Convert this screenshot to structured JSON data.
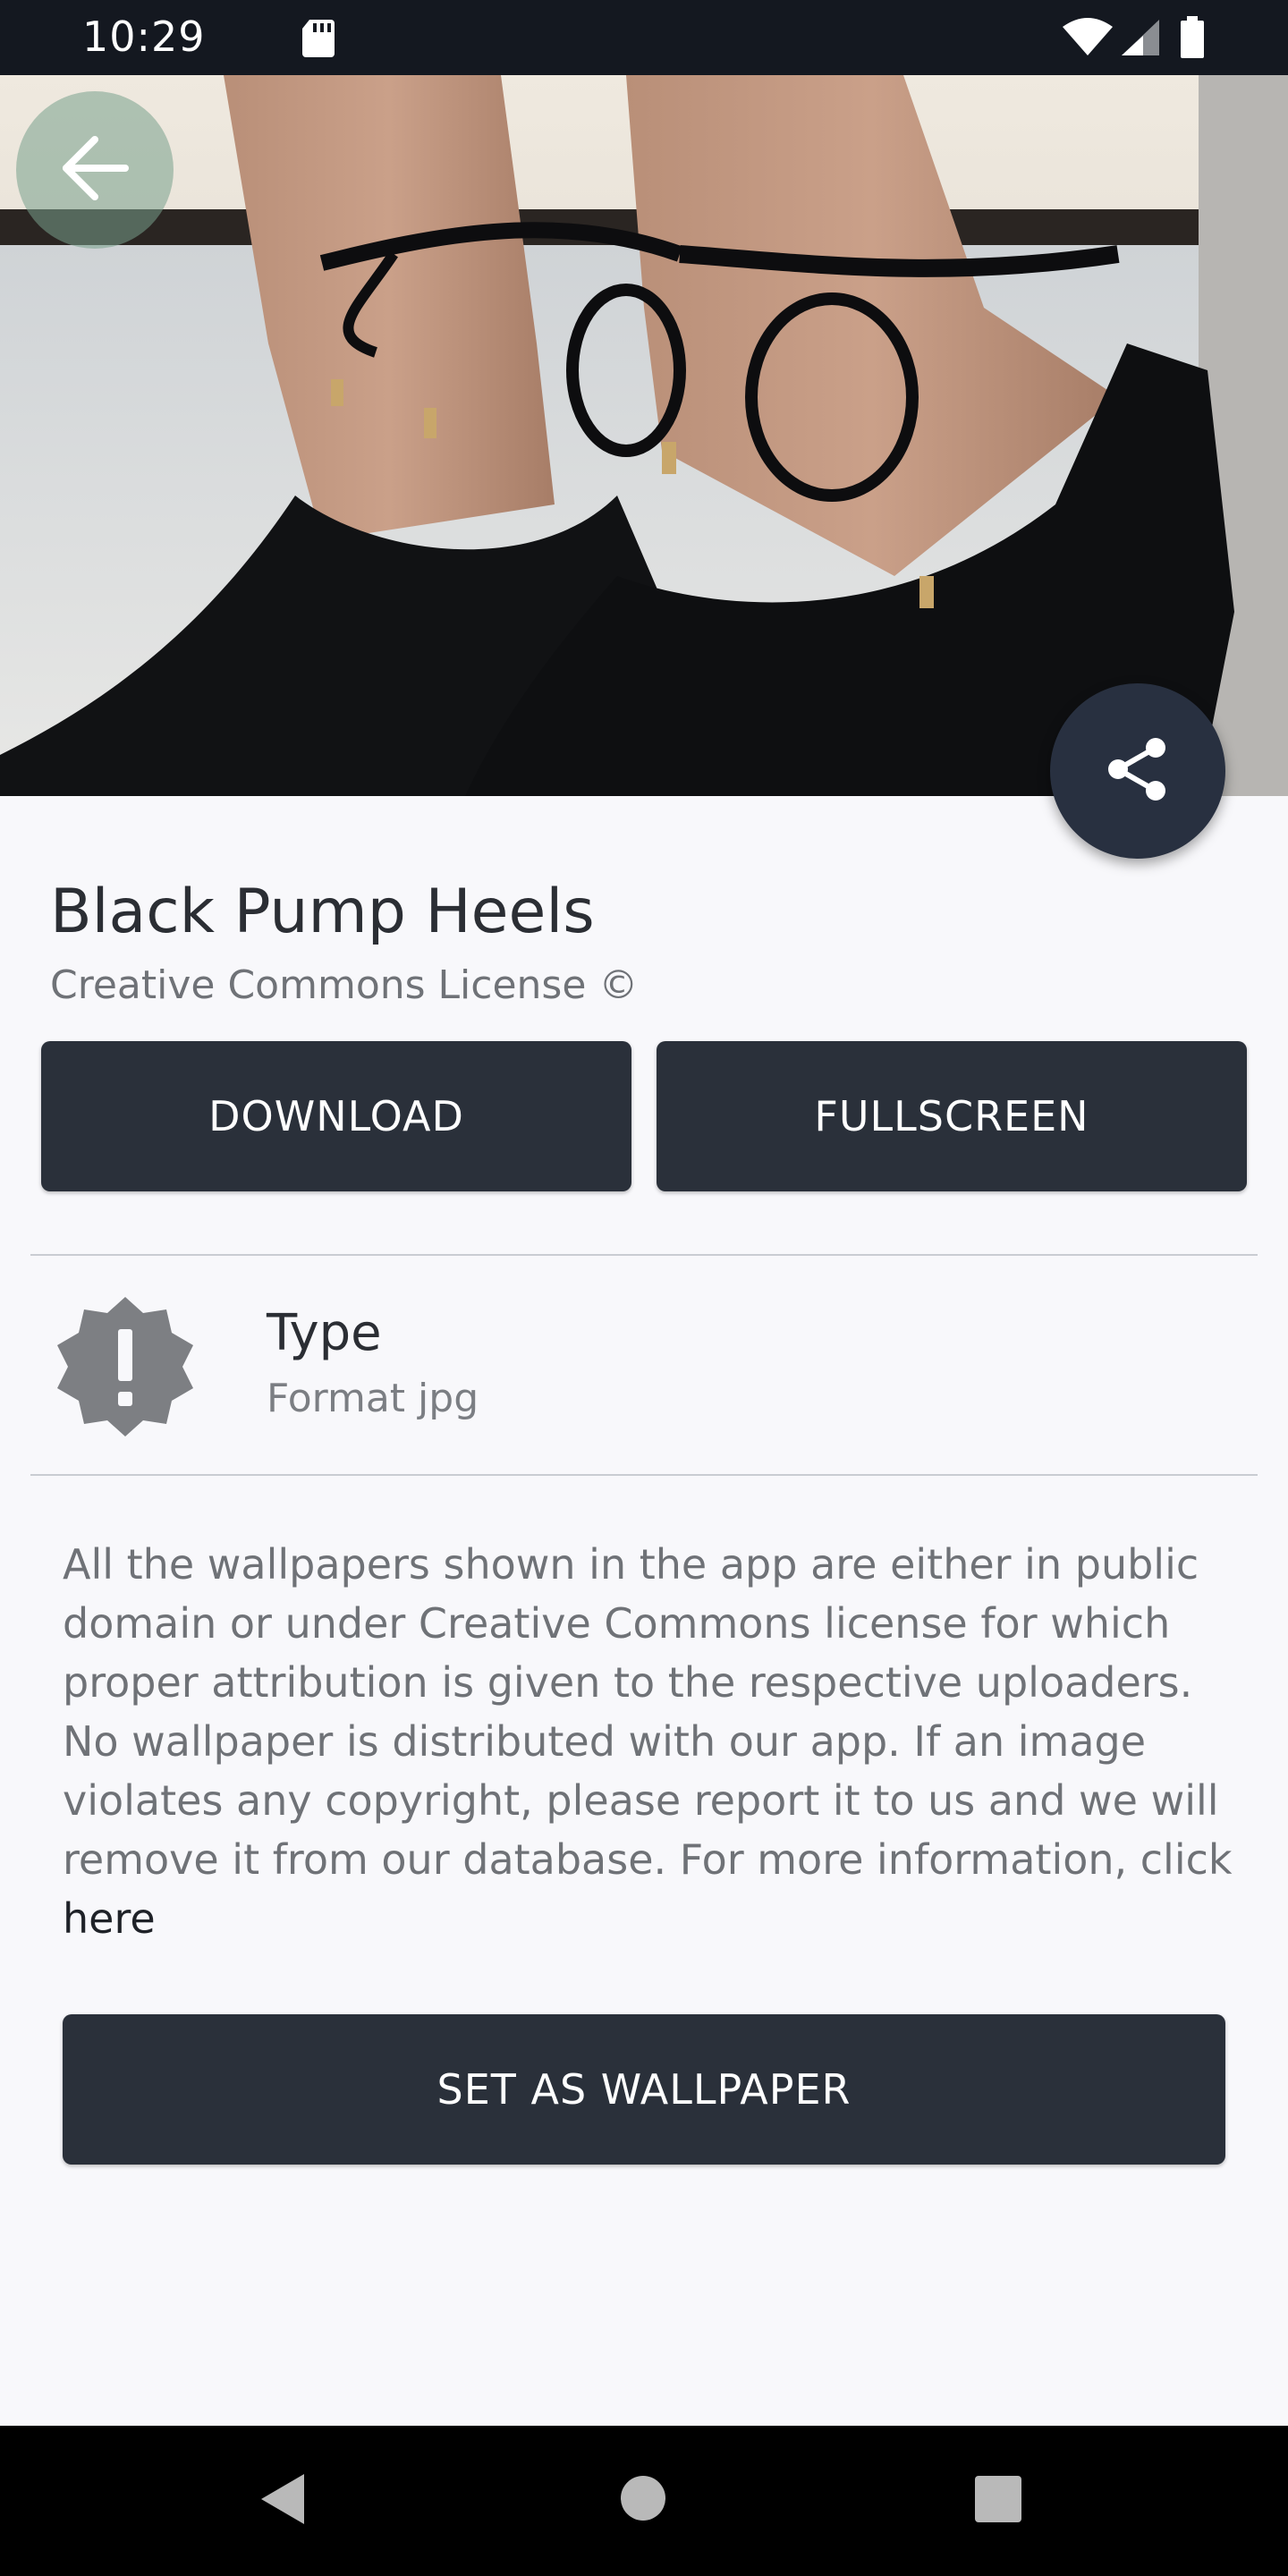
{
  "status_bar": {
    "time": "10:29",
    "icons": [
      "sd-card-icon",
      "wifi-icon",
      "signal-icon",
      "battery-icon"
    ]
  },
  "hero": {
    "image": "photo of black suede pump heels with ankle ties",
    "back_icon": "arrow-left-icon",
    "share_icon": "share-icon"
  },
  "wallpaper": {
    "title": "Black Pump Heels",
    "license": "Creative Commons License ©"
  },
  "actions": {
    "download_label": "DOWNLOAD",
    "fullscreen_label": "FULLSCREEN",
    "set_wallpaper_label": "SET AS WALLPAPER"
  },
  "info": {
    "icon": "alert-badge-icon",
    "label": "Type",
    "value": "Format jpg"
  },
  "disclaimer": {
    "text": "All the wallpapers shown in the app are either in public domain or under Creative Commons license for which proper attribution is given to the respective uploaders. No wallpaper is distributed with our app. If an image violates any copyright, please report it to us and we will remove it from our database. For more information, click ",
    "link_label": "here"
  },
  "nav_bar": {
    "icons": [
      "nav-back-icon",
      "nav-home-icon",
      "nav-recents-icon"
    ]
  },
  "colors": {
    "status_bar": "#141820",
    "button": "#2a303a",
    "background": "#f8f8fb",
    "nav_bar": "#000000"
  }
}
